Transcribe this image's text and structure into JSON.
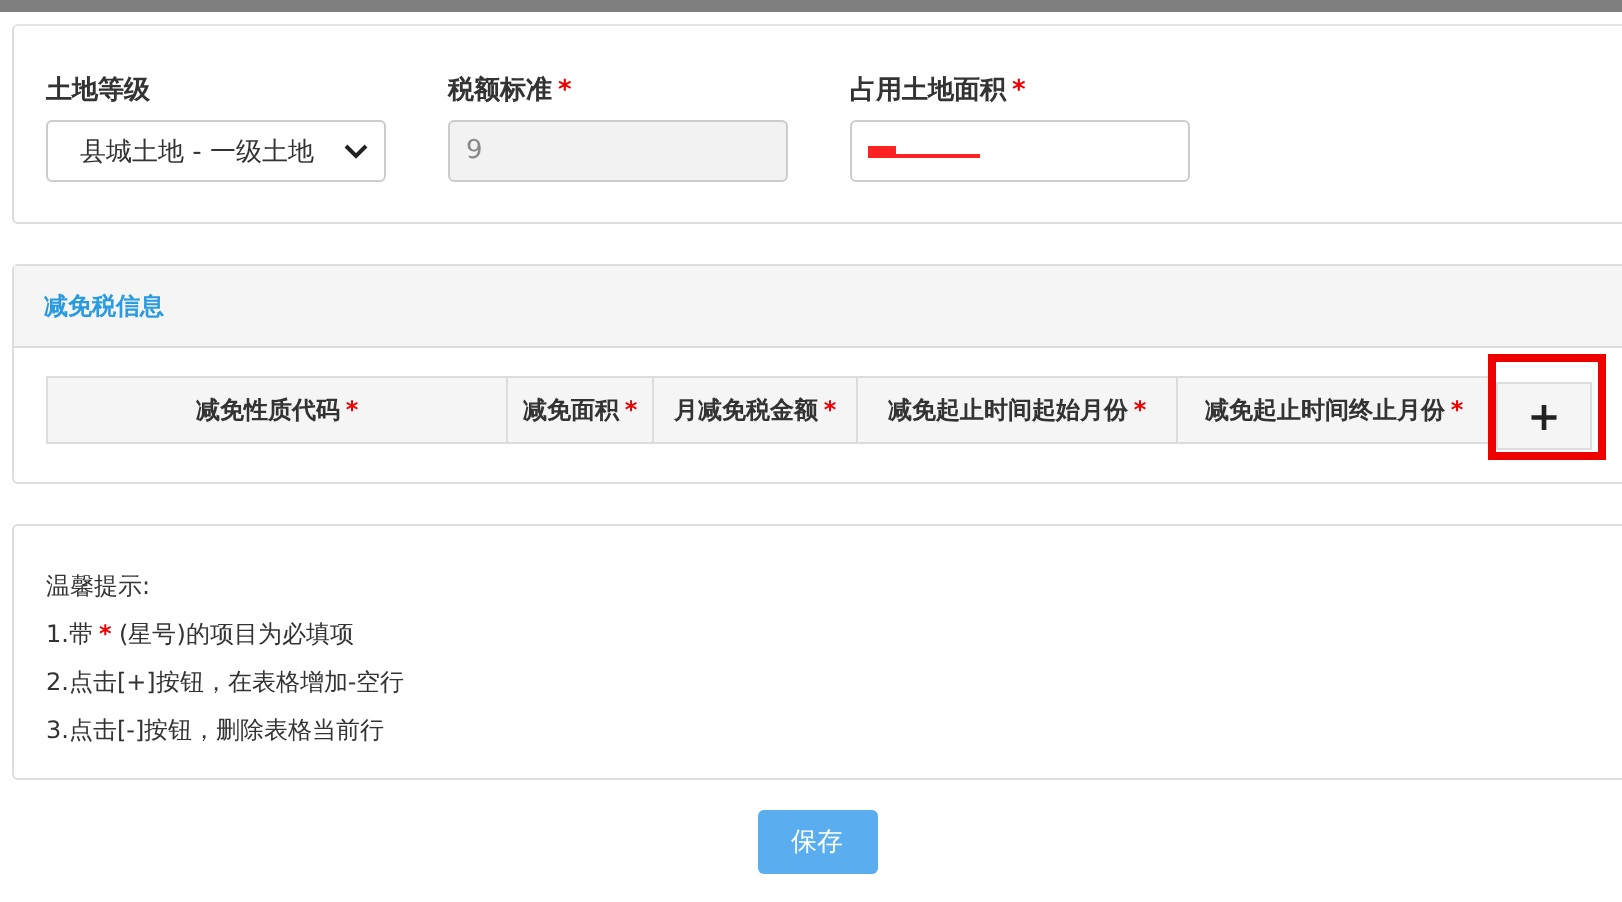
{
  "fields": [
    {
      "label": "土地等级",
      "required": false,
      "kind": "select",
      "value": "县城土地 - 一级土地",
      "disabled": false
    },
    {
      "label": "税额标准",
      "required": true,
      "kind": "input",
      "value": "9",
      "disabled": true
    },
    {
      "label": "占用土地面积",
      "required": true,
      "kind": "redacted",
      "disabled": false
    }
  ],
  "relief": {
    "title": "减免税信息",
    "columns": [
      {
        "label": "减免性质代码",
        "required": true
      },
      {
        "label": "减免面积",
        "required": true
      },
      {
        "label": "月减免税金额",
        "required": true
      },
      {
        "label": "减免起止时间起始月份",
        "required": true
      },
      {
        "label": "减免起止时间终止月份",
        "required": true
      }
    ],
    "add_button": "+",
    "add_highlighted": true
  },
  "tips": {
    "title": "温馨提示:",
    "lines": [
      [
        {
          "text": "1.带",
          "kind": "plain"
        },
        {
          "text": "*",
          "kind": "asterisk"
        },
        {
          "text": " (星号)的项目为必填项",
          "kind": "plain"
        }
      ],
      [
        {
          "text": "2.点击[+]按钮，在表格增加-空行",
          "kind": "plain"
        }
      ],
      [
        {
          "text": "3.点击[-]按钮，删除表格当前行",
          "kind": "plain"
        }
      ]
    ]
  },
  "save_button": "保存"
}
